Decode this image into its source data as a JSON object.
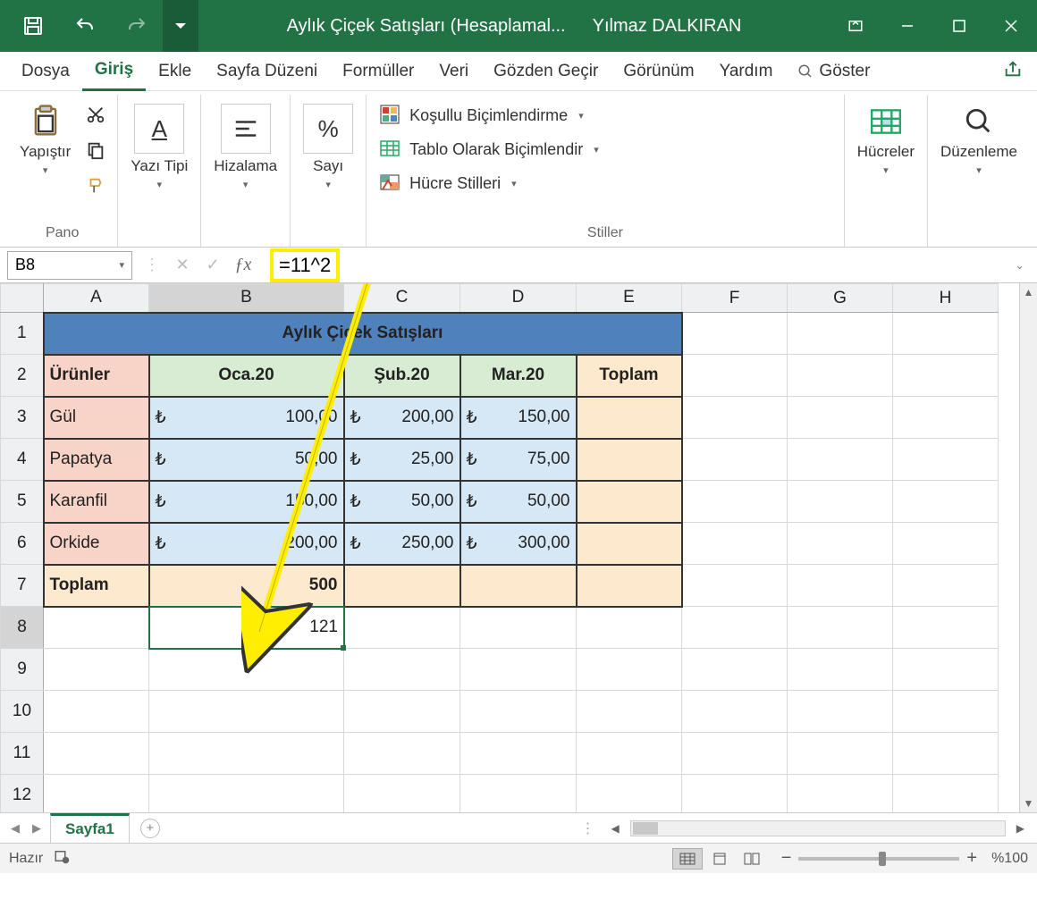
{
  "titlebar": {
    "doc_title": "Aylık Çiçek Satışları (Hesaplamal...",
    "user_name": "Yılmaz DALKIRAN"
  },
  "ribbon": {
    "tabs": [
      "Dosya",
      "Giriş",
      "Ekle",
      "Sayfa Düzeni",
      "Formüller",
      "Veri",
      "Gözden Geçir",
      "Görünüm",
      "Yardım"
    ],
    "active_tab": "Giriş",
    "tell_me": "Göster",
    "groups": {
      "pano": {
        "label": "Pano",
        "paste": "Yapıştır"
      },
      "font": {
        "label": "Yazı Tipi"
      },
      "align": {
        "label": "Hizalama"
      },
      "number": {
        "label": "Sayı"
      },
      "styles": {
        "label": "Stiller",
        "conditional": "Koşullu Biçimlendirme",
        "format_table": "Tablo Olarak Biçimlendir",
        "cell_styles": "Hücre Stilleri"
      },
      "cells": {
        "label": "Hücreler"
      },
      "editing": {
        "label": "Düzenleme"
      }
    }
  },
  "formula_bar": {
    "name_box": "B8",
    "formula": "=11^2"
  },
  "grid": {
    "columns": [
      "A",
      "B",
      "C",
      "D",
      "E",
      "F",
      "G",
      "H"
    ],
    "rows": [
      "1",
      "2",
      "3",
      "4",
      "5",
      "6",
      "7",
      "8",
      "9",
      "10",
      "11",
      "12"
    ],
    "title": "Aylık Çiçek Satışları",
    "headers": {
      "products": "Ürünler",
      "months": [
        "Oca.20",
        "Şub.20",
        "Mar.20"
      ],
      "total": "Toplam"
    },
    "data": [
      {
        "name": "Gül",
        "m1": "100,00",
        "m2": "200,00",
        "m3": "150,00"
      },
      {
        "name": "Papatya",
        "m1": "50,00",
        "m2": "25,00",
        "m3": "75,00"
      },
      {
        "name": "Karanfil",
        "m1": "150,00",
        "m2": "50,00",
        "m3": "50,00"
      },
      {
        "name": "Orkide",
        "m1": "200,00",
        "m2": "250,00",
        "m3": "300,00"
      }
    ],
    "currency": "₺",
    "total_label": "Toplam",
    "total_b": "500",
    "b8_value": "121"
  },
  "sheets": {
    "active": "Sayfa1"
  },
  "statusbar": {
    "ready": "Hazır",
    "zoom": "%100"
  }
}
